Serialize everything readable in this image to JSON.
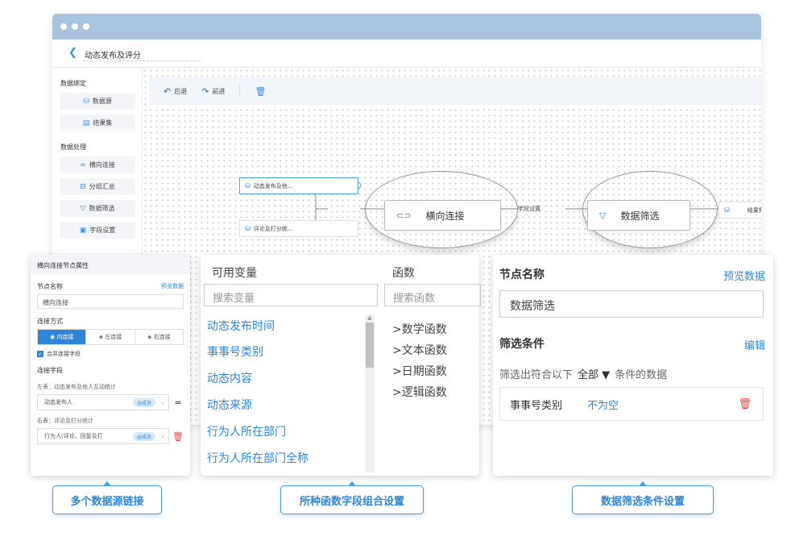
{
  "window": {
    "title": "动态发布及评分"
  },
  "left_panel": {
    "section1": "数据绑定",
    "items1": [
      {
        "icon": "database-icon",
        "label": "数据源"
      },
      {
        "icon": "table-icon",
        "label": "结果集"
      }
    ],
    "section2": "数据处理",
    "items2": [
      {
        "icon": "join-icon",
        "label": "横向连接"
      },
      {
        "icon": "group-icon",
        "label": "分组汇总"
      },
      {
        "icon": "filter-icon",
        "label": "数据筛选"
      },
      {
        "icon": "field-icon",
        "label": "字段设置"
      }
    ]
  },
  "toolbar": {
    "back": "后退",
    "forward": "前进"
  },
  "flow": {
    "source1": "动态发布及他...",
    "source2": "评论及打分统...",
    "join_node": "横向连接",
    "field_node": "字段设置",
    "filter_node": "数据筛选",
    "result_node": "结果集"
  },
  "join_panel": {
    "title": "横向连接节点属性",
    "node_name_label": "节点名称",
    "preview_link": "预览数据",
    "node_name_value": "横向连接",
    "join_type_label": "连接方式",
    "join_types": [
      "内连接",
      "左连接",
      "右连接"
    ],
    "merge_checkbox": "合并连接字段",
    "join_field_label": "连接字段",
    "left_table_label": "左表：动态发布及他人互动统计",
    "left_field": "动态发布人",
    "left_tag": "@成员",
    "right_table_label": "右表：评论及打分统计",
    "right_field": "行为人(评论、回复及打",
    "right_tag": "@成员",
    "equals": "="
  },
  "formula_panel": {
    "vars_title": "可用变量",
    "funcs_title": "函数",
    "var_search_placeholder": "搜索变量",
    "func_search_placeholder": "搜索函数",
    "variables": [
      "动态发布时间",
      "事事号类别",
      "动态内容",
      "动态来源",
      "行为人所在部门",
      "行为人所在部门全称"
    ],
    "functions": [
      ">数学函数",
      ">文本函数",
      ">日期函数",
      ">逻辑函数"
    ]
  },
  "filter_panel": {
    "node_name_label": "节点名称",
    "preview_link": "预览数据",
    "node_name_value": "数据筛选",
    "condition_label": "筛选条件",
    "edit_link": "编辑",
    "condition_prefix": "筛选出符合以下",
    "condition_mode": "全部",
    "condition_suffix": "条件的数据",
    "rule_field": "事事号类别",
    "rule_op": "不为空"
  },
  "captions": [
    "多个数据源链接",
    "所种函数字段组合设置",
    "数据筛选条件设置"
  ],
  "colors": {
    "accent": "#2f86d6",
    "titlebar": "#a9c4dc",
    "delete": "#e04a4a"
  }
}
